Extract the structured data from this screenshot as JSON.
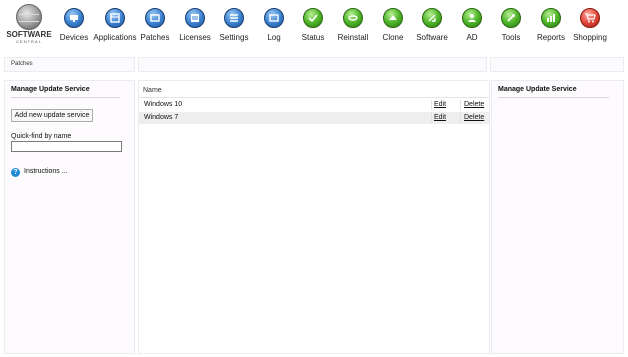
{
  "brand": {
    "line1": "SOFTWARE",
    "line2": "CENTRAL"
  },
  "toolbar": {
    "items": [
      {
        "label": "Devices",
        "icon": "monitor-icon",
        "color": "blue"
      },
      {
        "label": "Applications",
        "icon": "apps-icon",
        "color": "blue"
      },
      {
        "label": "Patches",
        "icon": "patches-icon",
        "color": "blue"
      },
      {
        "label": "Licenses",
        "icon": "license-icon",
        "color": "blue"
      },
      {
        "label": "Settings",
        "icon": "settings-icon",
        "color": "blue"
      },
      {
        "label": "Log",
        "icon": "log-icon",
        "color": "blue"
      },
      {
        "label": "Status",
        "icon": "status-check-icon",
        "color": "green"
      },
      {
        "label": "Reinstall",
        "icon": "reinstall-icon",
        "color": "green"
      },
      {
        "label": "Clone",
        "icon": "clone-icon",
        "color": "green"
      },
      {
        "label": "Software",
        "icon": "software-icon",
        "color": "green"
      },
      {
        "label": "AD",
        "icon": "users-icon",
        "color": "green"
      },
      {
        "label": "Tools",
        "icon": "wrench-icon",
        "color": "green"
      },
      {
        "label": "Reports",
        "icon": "reports-icon",
        "color": "green"
      },
      {
        "label": "Shopping",
        "icon": "cart-icon",
        "color": "red"
      }
    ]
  },
  "breadcrumb": {
    "label": "Patches"
  },
  "left_panel": {
    "title": "Manage Update Service",
    "add_button": "Add new update service",
    "quickfind_label": "Quick-find by name",
    "quickfind_value": "",
    "help_label": "Instructions ..."
  },
  "table": {
    "header": "Name",
    "rows": [
      {
        "name": "Windows 10",
        "edit": "Edit",
        "delete": "Delete"
      },
      {
        "name": "Windows 7",
        "edit": "Edit",
        "delete": "Delete"
      }
    ]
  },
  "right_panel": {
    "title": "Manage Update Service"
  },
  "colors": {
    "blue_icon": "#3f86d3",
    "green_icon": "#4fb52a",
    "red_icon": "#e24a3c",
    "row_alt": "#eeeeee",
    "help": "#1e8ad6"
  }
}
